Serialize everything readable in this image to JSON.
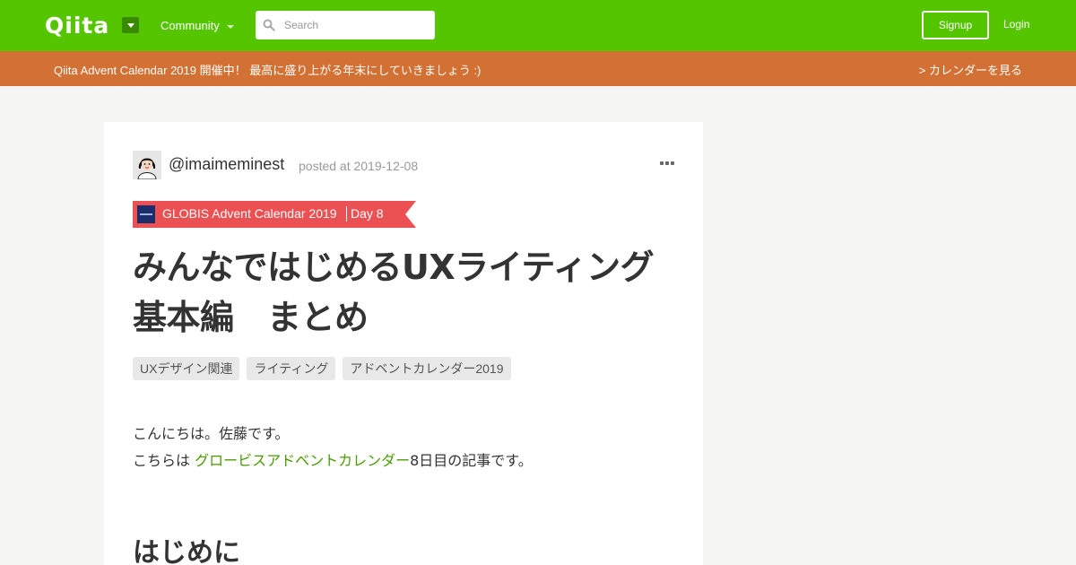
{
  "header": {
    "logo": "Qiita",
    "community_label": "Community",
    "search_placeholder": "Search",
    "signup_label": "Signup",
    "login_label": "Login",
    "brand_color": "#55c500"
  },
  "announcement": {
    "message": "Qiita Advent Calendar 2019 開催中！ 最高に盛り上がる年末にしていきましょう :)",
    "calendar_link": "> カレンダーを見る",
    "color": "#d37033"
  },
  "article": {
    "username": "@imaimeminest",
    "posted": "posted at 2019-12-08",
    "advent_name": "GLOBIS Advent Calendar 2019",
    "advent_day": "Day 8",
    "advent_color": "#eb5153",
    "title": "みんなではじめるUXライティング　基本編　まとめ",
    "tags": [
      "UXデザイン関連",
      "ライティング",
      "アドベントカレンダー2019"
    ],
    "body": {
      "line1": "こんにちは。佐藤です。",
      "line2_prefix": "こちらは ",
      "line2_link": "グロービスアドベントカレンダー",
      "line2_suffix": "8日目の記事です。"
    },
    "heading1": "はじめに"
  }
}
